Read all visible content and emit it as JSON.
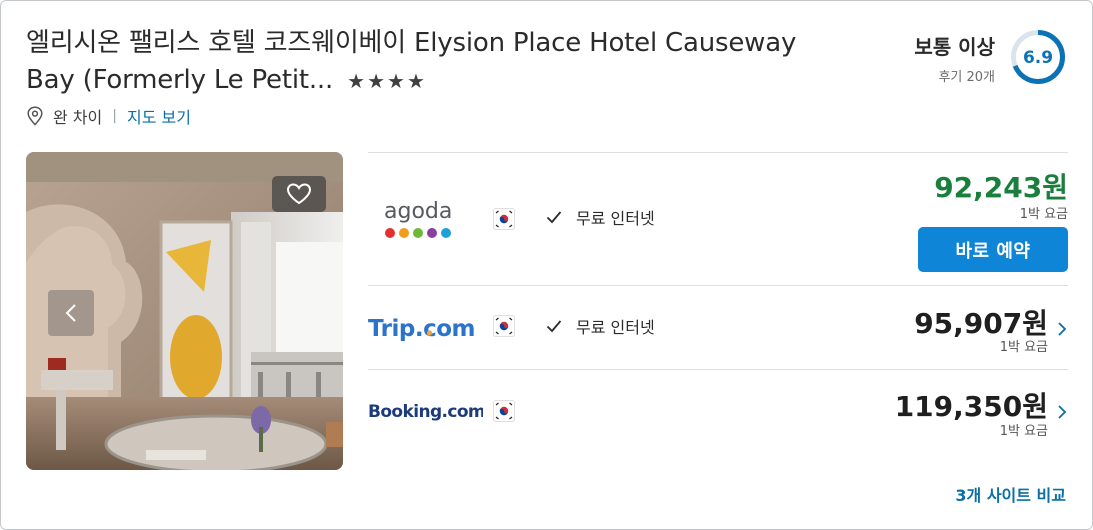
{
  "hotel": {
    "name": "엘리시온 팰리스 호텔 코즈웨이베이 Elysion Place Hotel Causeway Bay (Formerly Le Petit...",
    "stars": "★★★★",
    "area": "완 차이",
    "map_link": "지도 보기",
    "photo_alt": "호텔 객실 사진"
  },
  "rating": {
    "label": "보통 이상",
    "reviews": "후기 20개",
    "score": "6.9",
    "score_value": 6.9,
    "accent_color": "#0b72b5"
  },
  "deals": [
    {
      "provider": "agoda",
      "flag": "kr-flag-icon",
      "amenity": "무료 인터넷",
      "price": "92,243원",
      "price_note": "1박 요금",
      "price_color": "#1a7f3c",
      "cta": "바로 예약"
    },
    {
      "provider": "Trip.com",
      "flag": "kr-flag-icon",
      "amenity": "무료 인터넷",
      "price": "95,907원",
      "price_note": "1박 요금",
      "price_color": "#1f1f1f"
    },
    {
      "provider": "Booking.com",
      "flag": "kr-flag-icon",
      "amenity": "",
      "price": "119,350원",
      "price_note": "1박 요금",
      "price_color": "#1f1f1f"
    }
  ],
  "compare_link": "3개 사이트 비교",
  "colors": {
    "primary_button": "#0e85d6",
    "link": "#0a6ea8",
    "best_price": "#1a7f3c"
  }
}
